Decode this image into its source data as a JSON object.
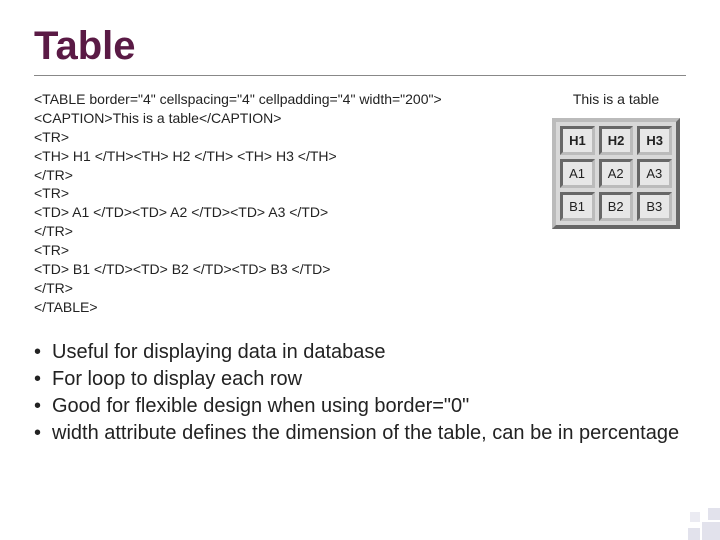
{
  "title": "Table",
  "code_lines": [
    "<TABLE border=\"4\" cellspacing=\"4\" cellpadding=\"4\" width=\"200\">",
    "<CAPTION>This is a table</CAPTION>",
    "<TR>",
    "<TH> H1 </TH><TH> H2 </TH> <TH> H3 </TH>",
    "</TR>",
    "<TR>",
    "<TD> A1 </TD><TD> A2 </TD><TD> A3 </TD>",
    "</TR>",
    "<TR>",
    "<TD> B1 </TD><TD> B2 </TD><TD> B3 </TD>",
    "</TR>",
    "</TABLE>"
  ],
  "demo": {
    "caption": "This is a table",
    "headers": [
      "H1",
      "H2",
      "H3"
    ],
    "rows": [
      [
        "A1",
        "A2",
        "A3"
      ],
      [
        "B1",
        "B2",
        "B3"
      ]
    ]
  },
  "bullets": [
    "Useful for displaying data in database",
    "For loop to display each row",
    "Good for flexible design when using border=\"0\"",
    "width attribute defines the dimension of the table, can be in percentage"
  ],
  "colors": {
    "title": "#5a1a45"
  }
}
